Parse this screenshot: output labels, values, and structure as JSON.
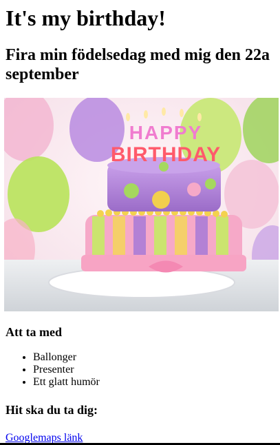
{
  "header": {
    "title": "It's my birthday!",
    "subtitle": "Fira min födelsedag med mig den 22a september"
  },
  "hero_image": {
    "icon": "birthday-cake-image",
    "caption_on_image": "HAPPY BIRTHDAY"
  },
  "bring_section": {
    "heading": "Att ta med",
    "items": [
      "Ballonger",
      "Presenter",
      "Ett glatt humör"
    ]
  },
  "location_section": {
    "heading": "Hit ska du ta dig:",
    "link_text": "Googlemaps länk"
  },
  "colors": {
    "link": "#0000ee",
    "cake_purple": "#b07fd6",
    "cake_pink": "#f6a9c8",
    "balloon_green": "#b8e35a"
  }
}
